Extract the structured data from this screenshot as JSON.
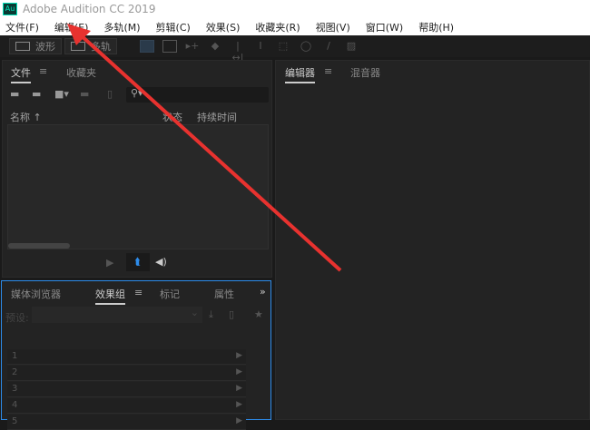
{
  "app": {
    "logo": "Au",
    "title": "Adobe Audition CC 2019"
  },
  "menu": [
    "文件(F)",
    "编辑(E)",
    "多轨(M)",
    "剪辑(C)",
    "效果(S)",
    "收藏夹(R)",
    "视图(V)",
    "窗口(W)",
    "帮助(H)"
  ],
  "toolbar": {
    "waveform": "波形",
    "multitrack": "多轨"
  },
  "files_panel": {
    "tabs": [
      "文件",
      "收藏夹"
    ],
    "columns": {
      "name": "名称 ↑",
      "status": "状态",
      "duration": "持续时间"
    }
  },
  "editor_panel": {
    "tabs": [
      "编辑器",
      "混音器"
    ]
  },
  "effects_panel": {
    "tabs": [
      "媒体浏览器",
      "效果组",
      "标记",
      "属性"
    ],
    "preset_label": "预设:",
    "rows": [
      "1",
      "2",
      "3",
      "4",
      "5"
    ]
  },
  "colors": {
    "accent": "#2d8ceb",
    "annotation": "#e8322f"
  }
}
